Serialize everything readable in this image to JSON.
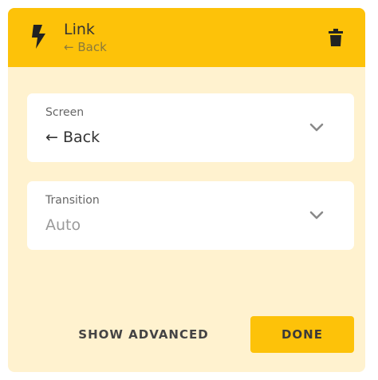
{
  "header": {
    "title": "Link",
    "subtitle": "← Back",
    "bg_color": "#fdc209",
    "left_icon": "lightning-bolt-icon",
    "right_icon": "trash-icon"
  },
  "fields": [
    {
      "label": "Screen",
      "value": "← Back",
      "icon": "chevron-down-icon"
    },
    {
      "label": "Transition",
      "value": "Auto",
      "icon": "chevron-down-icon"
    }
  ],
  "actions": {
    "show_advanced_label": "SHOW ADVANCED",
    "done_label": "DONE"
  },
  "colors": {
    "panel_bg": "#fff2cf",
    "accent": "#fdc209"
  }
}
